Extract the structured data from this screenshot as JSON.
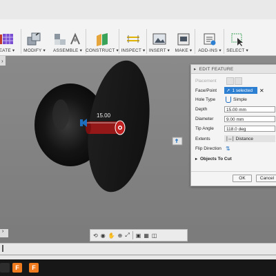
{
  "toolbar": {
    "groups": [
      {
        "label": "EATE ▾"
      },
      {
        "label": "MODIFY ▾"
      },
      {
        "label": "ASSEMBLE ▾"
      },
      {
        "label": "CONSTRUCT ▾"
      },
      {
        "label": "INSPECT ▾"
      },
      {
        "label": "INSERT ▾"
      },
      {
        "label": "MAKE ▾"
      },
      {
        "label": "ADD-INS ▾"
      },
      {
        "label": "SELECT ▾"
      }
    ]
  },
  "viewport": {
    "dimension_value": "15.00",
    "colors": {
      "accent": "#1e6fc0",
      "hole": "#a21818"
    }
  },
  "panel": {
    "title": "EDIT FEATURE",
    "placement_label": "Placement",
    "face_point_label": "Face/Point",
    "face_point_value": "1 selected",
    "hole_type_label": "Hole Type",
    "hole_type_value": "Simple",
    "depth_label": "Depth",
    "depth_value": "15.00 mm",
    "diameter_label": "Diameter",
    "diameter_value": "9.00 mm",
    "tip_angle_label": "Tip Angle",
    "tip_angle_value": "118.0 deg",
    "extents_label": "Extents",
    "extents_value": "Distance",
    "flip_direction_label": "Flip Direction",
    "objects_to_cut_label": "Objects To Cut",
    "ok_label": "OK",
    "cancel_label": "Cancel"
  },
  "taskbar": {
    "apps": [
      {
        "name": "fusion-360-app",
        "letter": "F",
        "color": "#f07b1f"
      },
      {
        "name": "fusion-file-app",
        "letter": "F",
        "color": "#f07b1f"
      }
    ]
  }
}
